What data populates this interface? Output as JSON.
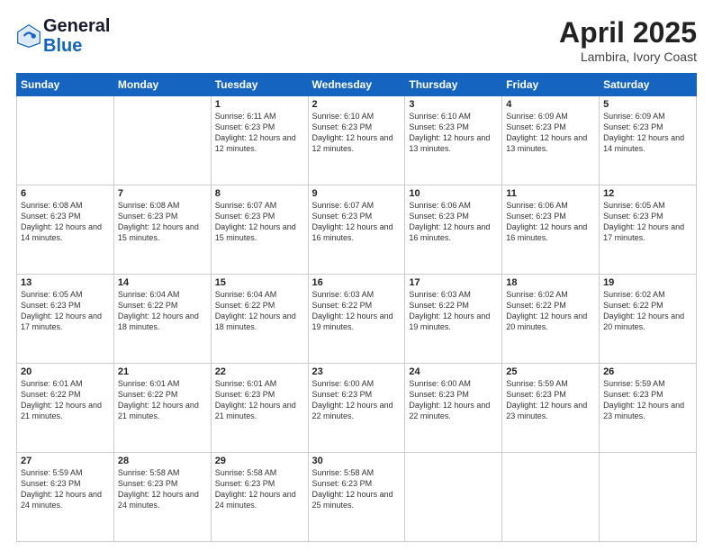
{
  "header": {
    "logo_general": "General",
    "logo_blue": "Blue",
    "month": "April 2025",
    "location": "Lambira, Ivory Coast"
  },
  "days_of_week": [
    "Sunday",
    "Monday",
    "Tuesday",
    "Wednesday",
    "Thursday",
    "Friday",
    "Saturday"
  ],
  "weeks": [
    [
      {
        "day": "",
        "info": ""
      },
      {
        "day": "",
        "info": ""
      },
      {
        "day": "1",
        "info": "Sunrise: 6:11 AM\nSunset: 6:23 PM\nDaylight: 12 hours and 12 minutes."
      },
      {
        "day": "2",
        "info": "Sunrise: 6:10 AM\nSunset: 6:23 PM\nDaylight: 12 hours and 12 minutes."
      },
      {
        "day": "3",
        "info": "Sunrise: 6:10 AM\nSunset: 6:23 PM\nDaylight: 12 hours and 13 minutes."
      },
      {
        "day": "4",
        "info": "Sunrise: 6:09 AM\nSunset: 6:23 PM\nDaylight: 12 hours and 13 minutes."
      },
      {
        "day": "5",
        "info": "Sunrise: 6:09 AM\nSunset: 6:23 PM\nDaylight: 12 hours and 14 minutes."
      }
    ],
    [
      {
        "day": "6",
        "info": "Sunrise: 6:08 AM\nSunset: 6:23 PM\nDaylight: 12 hours and 14 minutes."
      },
      {
        "day": "7",
        "info": "Sunrise: 6:08 AM\nSunset: 6:23 PM\nDaylight: 12 hours and 15 minutes."
      },
      {
        "day": "8",
        "info": "Sunrise: 6:07 AM\nSunset: 6:23 PM\nDaylight: 12 hours and 15 minutes."
      },
      {
        "day": "9",
        "info": "Sunrise: 6:07 AM\nSunset: 6:23 PM\nDaylight: 12 hours and 16 minutes."
      },
      {
        "day": "10",
        "info": "Sunrise: 6:06 AM\nSunset: 6:23 PM\nDaylight: 12 hours and 16 minutes."
      },
      {
        "day": "11",
        "info": "Sunrise: 6:06 AM\nSunset: 6:23 PM\nDaylight: 12 hours and 16 minutes."
      },
      {
        "day": "12",
        "info": "Sunrise: 6:05 AM\nSunset: 6:23 PM\nDaylight: 12 hours and 17 minutes."
      }
    ],
    [
      {
        "day": "13",
        "info": "Sunrise: 6:05 AM\nSunset: 6:23 PM\nDaylight: 12 hours and 17 minutes."
      },
      {
        "day": "14",
        "info": "Sunrise: 6:04 AM\nSunset: 6:22 PM\nDaylight: 12 hours and 18 minutes."
      },
      {
        "day": "15",
        "info": "Sunrise: 6:04 AM\nSunset: 6:22 PM\nDaylight: 12 hours and 18 minutes."
      },
      {
        "day": "16",
        "info": "Sunrise: 6:03 AM\nSunset: 6:22 PM\nDaylight: 12 hours and 19 minutes."
      },
      {
        "day": "17",
        "info": "Sunrise: 6:03 AM\nSunset: 6:22 PM\nDaylight: 12 hours and 19 minutes."
      },
      {
        "day": "18",
        "info": "Sunrise: 6:02 AM\nSunset: 6:22 PM\nDaylight: 12 hours and 20 minutes."
      },
      {
        "day": "19",
        "info": "Sunrise: 6:02 AM\nSunset: 6:22 PM\nDaylight: 12 hours and 20 minutes."
      }
    ],
    [
      {
        "day": "20",
        "info": "Sunrise: 6:01 AM\nSunset: 6:22 PM\nDaylight: 12 hours and 21 minutes."
      },
      {
        "day": "21",
        "info": "Sunrise: 6:01 AM\nSunset: 6:22 PM\nDaylight: 12 hours and 21 minutes."
      },
      {
        "day": "22",
        "info": "Sunrise: 6:01 AM\nSunset: 6:23 PM\nDaylight: 12 hours and 21 minutes."
      },
      {
        "day": "23",
        "info": "Sunrise: 6:00 AM\nSunset: 6:23 PM\nDaylight: 12 hours and 22 minutes."
      },
      {
        "day": "24",
        "info": "Sunrise: 6:00 AM\nSunset: 6:23 PM\nDaylight: 12 hours and 22 minutes."
      },
      {
        "day": "25",
        "info": "Sunrise: 5:59 AM\nSunset: 6:23 PM\nDaylight: 12 hours and 23 minutes."
      },
      {
        "day": "26",
        "info": "Sunrise: 5:59 AM\nSunset: 6:23 PM\nDaylight: 12 hours and 23 minutes."
      }
    ],
    [
      {
        "day": "27",
        "info": "Sunrise: 5:59 AM\nSunset: 6:23 PM\nDaylight: 12 hours and 24 minutes."
      },
      {
        "day": "28",
        "info": "Sunrise: 5:58 AM\nSunset: 6:23 PM\nDaylight: 12 hours and 24 minutes."
      },
      {
        "day": "29",
        "info": "Sunrise: 5:58 AM\nSunset: 6:23 PM\nDaylight: 12 hours and 24 minutes."
      },
      {
        "day": "30",
        "info": "Sunrise: 5:58 AM\nSunset: 6:23 PM\nDaylight: 12 hours and 25 minutes."
      },
      {
        "day": "",
        "info": ""
      },
      {
        "day": "",
        "info": ""
      },
      {
        "day": "",
        "info": ""
      }
    ]
  ]
}
